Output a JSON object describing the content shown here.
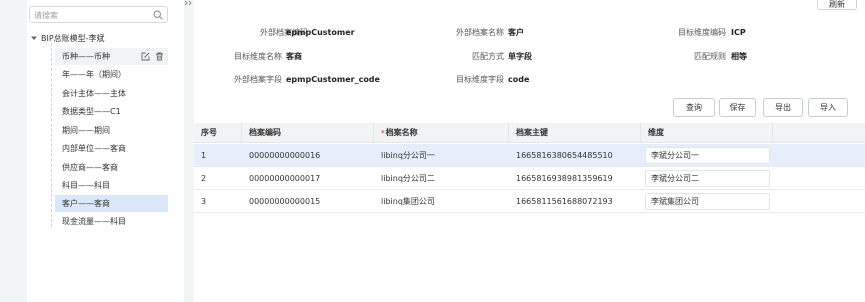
{
  "sidebar": {
    "search_placeholder": "请搜索",
    "root_label": "BIP总账模型-李斌",
    "items": [
      {
        "label": "币种——币种"
      },
      {
        "label": "年——年（期间）"
      },
      {
        "label": "会计主体——主体"
      },
      {
        "label": "数据类型——C1"
      },
      {
        "label": "期间——期间"
      },
      {
        "label": "内部单位——客商"
      },
      {
        "label": "供应商——客商"
      },
      {
        "label": "科目——科目"
      },
      {
        "label": "客户——客商"
      },
      {
        "label": "现金流量——科目"
      }
    ]
  },
  "toolbar_top": {
    "refresh_label": "刷新"
  },
  "details": {
    "ext_code_label": "外部档案编码",
    "ext_code_value": "epmpCustomer",
    "ext_name_label": "外部档案名称",
    "ext_name_value": "客户",
    "target_code_label": "目标维度编码",
    "target_code_value": "ICP",
    "target_name_label": "目标维度名称",
    "target_name_value": "客商",
    "match_mode_label": "匹配方式",
    "match_mode_value": "单字段",
    "match_rule_label": "匹配规则",
    "match_rule_value": "相等",
    "ext_field_label": "外部档案字段",
    "ext_field_value": "epmpCustomer_code",
    "target_field_label": "目标维度字段",
    "target_field_value": "code"
  },
  "actions": {
    "query": "查询",
    "save": "保存",
    "export": "导出",
    "import": "导入"
  },
  "table": {
    "headers": {
      "seq": "序号",
      "code": "档案编码",
      "name_required": "*",
      "name": "档案名称",
      "key": "档案主键",
      "dim": "维度"
    },
    "rows": [
      {
        "seq": "1",
        "code": "00000000000016",
        "name": "libinq分公司一",
        "key": "1665816380654485510",
        "dim": "李斌分公司一"
      },
      {
        "seq": "2",
        "code": "00000000000017",
        "name": "libinq分公司二",
        "key": "1665816938981359619",
        "dim": "李斌分公司二"
      },
      {
        "seq": "3",
        "code": "00000000000015",
        "name": "libinq集团公司",
        "key": "1665811561688072193",
        "dim": "李斌集团公司"
      }
    ]
  },
  "colors": {
    "selected_tree": "#dbe8fb",
    "selected_row": "#e6eefb",
    "required": "#e5484d"
  }
}
